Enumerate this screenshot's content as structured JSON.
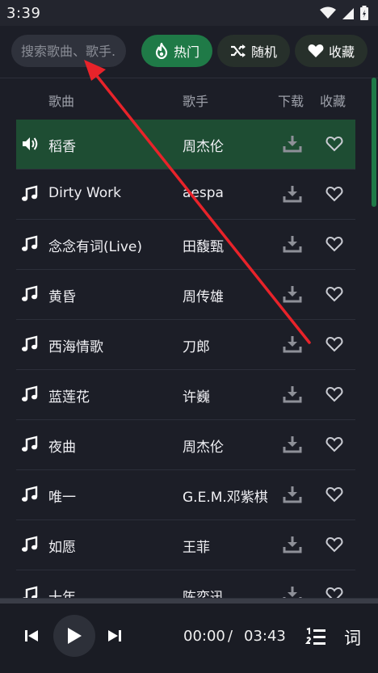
{
  "status": {
    "time": "3:39",
    "icons": [
      "wifi-icon",
      "signal-icon",
      "battery-icon"
    ]
  },
  "search": {
    "placeholder": "搜索歌曲、歌手..."
  },
  "filters": {
    "hot": "热门",
    "random": "随机",
    "favorites": "收藏"
  },
  "columns": {
    "song": "歌曲",
    "artist": "歌手",
    "download": "下载",
    "favorite": "收藏"
  },
  "songs": [
    {
      "title": "稻香",
      "artist": "周杰伦",
      "playing": true
    },
    {
      "title": "Dirty Work",
      "artist": "aespa",
      "playing": false
    },
    {
      "title": "念念有词(Live)",
      "artist": "田馥甄",
      "playing": false
    },
    {
      "title": "黄昏",
      "artist": "周传雄",
      "playing": false
    },
    {
      "title": "西海情歌",
      "artist": "刀郎",
      "playing": false
    },
    {
      "title": "蓝莲花",
      "artist": "许巍",
      "playing": false
    },
    {
      "title": "夜曲",
      "artist": "周杰伦",
      "playing": false
    },
    {
      "title": "唯一",
      "artist": "G.E.M.邓紫棋",
      "playing": false
    },
    {
      "title": "如愿",
      "artist": "王菲",
      "playing": false
    },
    {
      "title": "十年",
      "artist": "陈奕迅",
      "playing": false
    }
  ],
  "player": {
    "current_time": "00:00",
    "separator": "/",
    "total_time": "03:43",
    "progress": 0,
    "lyrics_label": "词"
  },
  "colors": {
    "accent": "#1f7a47",
    "background": "#1c1e27",
    "annotation": "#e8232a"
  }
}
